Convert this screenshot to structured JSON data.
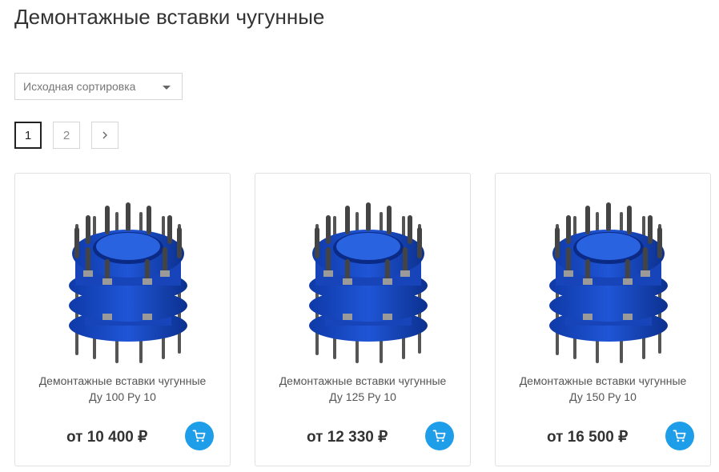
{
  "header": {
    "title": "Демонтажные вставки чугунные"
  },
  "sort": {
    "selected": "Исходная сортировка"
  },
  "pagination": {
    "pages": [
      "1",
      "2"
    ],
    "current": "1"
  },
  "colors": {
    "accent": "#1e9de8",
    "flange": "#1f55d6"
  },
  "products": [
    {
      "name_line1": "Демонтажные вставки чугунные",
      "name_line2": "Ду 100 Ру 10",
      "price": "от 10 400 ₽"
    },
    {
      "name_line1": "Демонтажные вставки чугунные",
      "name_line2": "Ду 125 Ру 10",
      "price": "от 12 330 ₽"
    },
    {
      "name_line1": "Демонтажные вставки чугунные",
      "name_line2": "Ду 150 Ру 10",
      "price": "от 16 500 ₽"
    }
  ]
}
